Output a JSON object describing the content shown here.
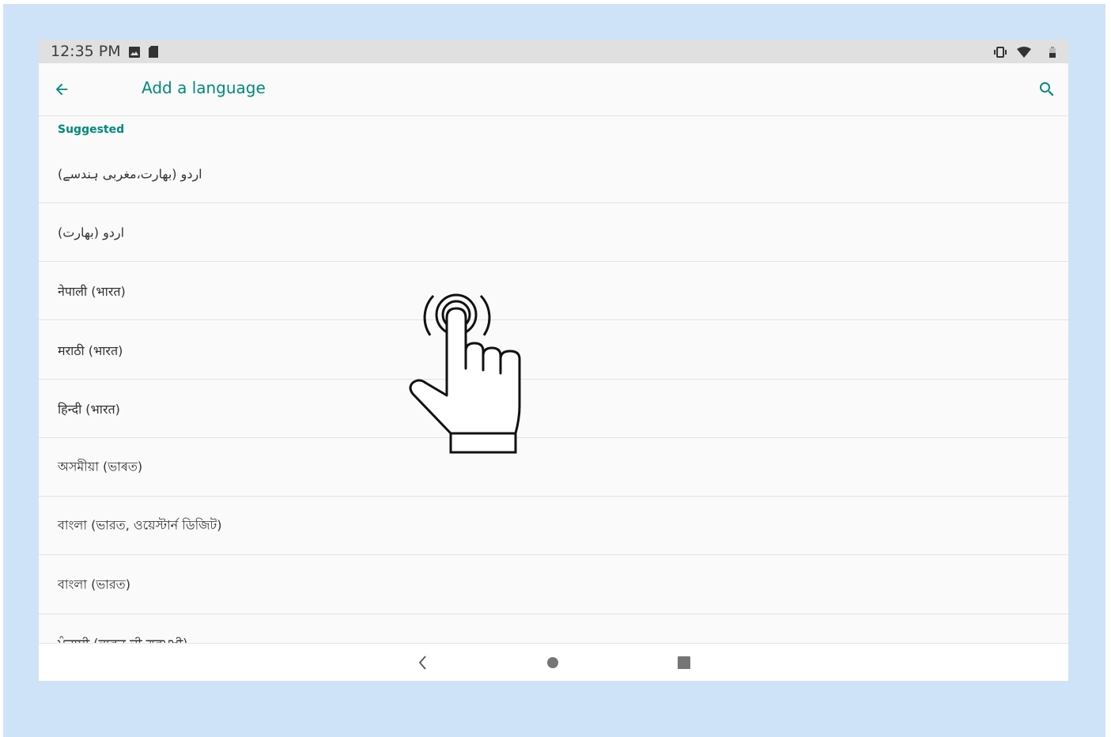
{
  "status_bar": {
    "time": "12:35 PM",
    "left_icons": [
      "image-icon",
      "sd-card-icon"
    ],
    "right_icons": [
      "vibrate-icon",
      "wifi-icon",
      "battery-icon"
    ]
  },
  "app_bar": {
    "back_icon": "arrow-back-icon",
    "title": "Add a language",
    "search_icon": "search-icon"
  },
  "list": {
    "section_header": "Suggested",
    "items": [
      {
        "label": "اردو (بھارت،مغربی ہندسے)"
      },
      {
        "label": "اردو (بھارت)"
      },
      {
        "label": "नेपाली (भारत)"
      },
      {
        "label": "मराठी (भारत)"
      },
      {
        "label": "हिन्दी (भारत)"
      },
      {
        "label": "অসমীয়া (ভাৰত)"
      },
      {
        "label": "বাংলা (ভারত, ওয়েস্টার্ন ডিজিট)"
      },
      {
        "label": "বাংলা (ভারত)"
      },
      {
        "label": "ਪੰਜਾਬੀ (ਭਾਰਤ ਦੀ ਗੁਰਮੁਖੀ)"
      }
    ]
  },
  "nav_bar": {
    "icons": [
      "nav-back-icon",
      "nav-home-icon",
      "nav-recents-icon"
    ]
  },
  "overlay": {
    "icon": "tap-gesture-hand-icon"
  },
  "colors": {
    "accent": "#00897b",
    "frame_background": "#cfe3f8",
    "status_bar": "#e0e0e0",
    "screen_background": "#fafafa"
  }
}
